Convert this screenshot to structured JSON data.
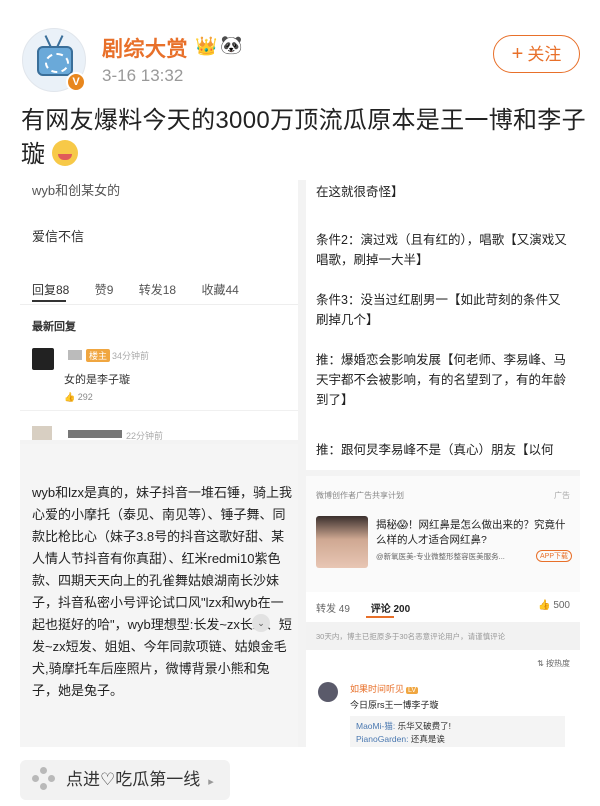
{
  "header": {
    "username": "剧综大赏",
    "time": "3-16 13:32",
    "follow_label": "关注",
    "follow_plus": "+",
    "verified_badge": "V",
    "crown_icon": "👑",
    "panda_icon": "🐼"
  },
  "post": {
    "text": "有网友爆料今天的3000万顶流瓜原本是王一博和李子璇",
    "emoji": "yum-face-emoji"
  },
  "collage": {
    "left_top": {
      "cut_line": "wyb和创某女的",
      "line2": "爱信不信",
      "tabs": [
        "回复88",
        "赞9",
        "转发18",
        "收藏44"
      ],
      "latest_label": "最新回复",
      "owner_badge": "楼主",
      "comment1_time": "34分钟前",
      "comment1_text": "女的是李子璇",
      "comment1_likes": "292",
      "comment2_time": "22分钟前"
    },
    "left_bottom": {
      "text": "wyb和lzx是真的，妹子抖音一堆石锤，骑上我心爱的小摩托（泰见、南见等）、锤子舞、同款比枪比心（妹子3.8号的抖音这歌好甜、某人情人节抖音有你真甜）、红米redmi10紫色款、四期天天向上的孔雀舞姑娘湖南长沙妹子，抖音私密小号评论试口风\"lzx和wyb在一起也挺好的哈\"，wyb理想型:长发~zx长发、短发~zx短发、姐姐、今年同款项链、姑娘金毛犬,骑摩托车后座照片，微博背景小熊和兔子，她是兔子。",
      "more_icon": "⌄"
    },
    "right_top": {
      "lines": [
        "在这就很奇怪】",
        "条件2：演过戏（且有红的），唱歌【又演戏又唱歌，刷掉一大半】",
        "条件3：没当过红剧男一【如此苛刻的条件又刷掉几个】",
        "推：爆婚恋会影响发展【何老师、李易峰、马天宇都不会被影响，有的名望到了，有的年龄到了】",
        "推：跟何炅李易峰不是（真心）朋友【以何"
      ]
    },
    "right_bottom": {
      "ad_label": "微博创作者广告共享计划",
      "ad_tag": "广告",
      "ad_title": "揭秘😱！网红鼻是怎么做出来的？究竟什么样的人才适合网红鼻?",
      "ad_sub": "@新氧医美-专业微整形整容医美服务...",
      "ad_button": "APP下载",
      "tab_forward": "转发 49",
      "tab_comment": "评论 200",
      "likes": "500",
      "notice": "30天内，博主已拒原多于30名恶意评论用户，请谨慎评论",
      "sort": "按热度",
      "commenter": "如果时间听见",
      "commenter_level": "LV",
      "comment_text": "今日原rs王一博李子璇",
      "replies": [
        {
          "user": "MaoMi-猫:",
          "text": " 乐华又破费了!"
        },
        {
          "user": "PianoGarden:",
          "text": " 还真是诶"
        }
      ]
    }
  },
  "topic": {
    "label": "点进♡吃瓜第一线",
    "arrow": "▸"
  },
  "colors": {
    "accent": "#e8702a",
    "text": "#222222",
    "muted": "#999999"
  }
}
